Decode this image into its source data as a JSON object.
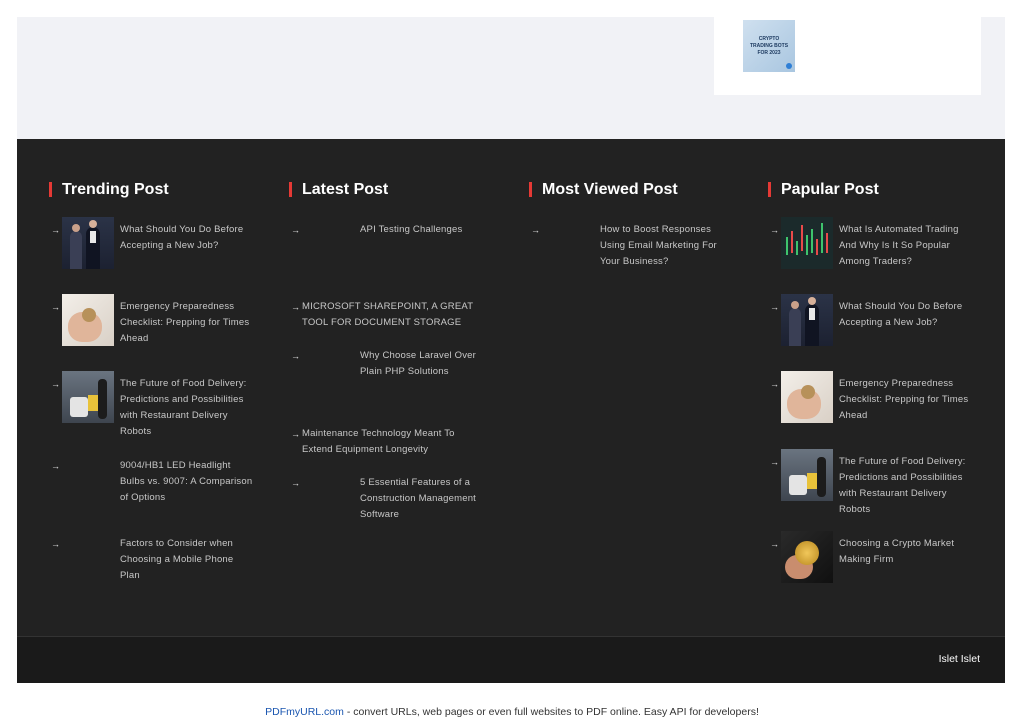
{
  "sidebar_card": {
    "thumb_text": "CRYPTO TRADING BOTS FOR 2023"
  },
  "columns": [
    {
      "title": "Trending Post",
      "items": [
        {
          "text": "What Should You Do Before Accepting a New Job?",
          "thumb": "job-interview-photo"
        },
        {
          "text": "Emergency Preparedness Checklist: Prepping for Times Ahead",
          "thumb": "hand-coin-photo"
        },
        {
          "text": "The Future of Food Delivery: Predictions and Possibilities with Restaurant Delivery Robots",
          "thumb": "delivery-robot-photo"
        },
        {
          "text": "9004/HB1 LED Headlight Bulbs vs. 9007: A Comparison of Options",
          "thumb": ""
        },
        {
          "text": "Factors to Consider when Choosing a Mobile Phone Plan",
          "thumb": ""
        }
      ]
    },
    {
      "title": "Latest Post",
      "items": [
        {
          "text": "API Testing Challenges",
          "thumb": ""
        },
        {
          "text": "MICROSOFT SHAREPOINT, A GREAT TOOL FOR DOCUMENT STORAGE",
          "thumb": "none"
        },
        {
          "text": "Why Choose Laravel Over Plain PHP Solutions",
          "thumb": ""
        },
        {
          "text": "Maintenance Technology Meant To Extend Equipment Longevity",
          "thumb": "none"
        },
        {
          "text": "5 Essential Features of a Construction Management Software",
          "thumb": ""
        }
      ]
    },
    {
      "title": "Most Viewed Post",
      "items": [
        {
          "text": "How to Boost Responses Using Email Marketing For Your Business?",
          "thumb": ""
        }
      ]
    },
    {
      "title": "Papular Post",
      "items": [
        {
          "text": "What Is Automated Trading And Why Is It So Popular Among Traders?",
          "thumb": "trading-chart-photo"
        },
        {
          "text": "What Should You Do Before Accepting a New Job?",
          "thumb": "job-interview-photo"
        },
        {
          "text": "Emergency Preparedness Checklist: Prepping for Times Ahead",
          "thumb": "hand-coin-photo"
        },
        {
          "text": "The Future of Food Delivery: Predictions and Possibilities with Restaurant Delivery Robots",
          "thumb": "delivery-robot-photo"
        },
        {
          "text": "Choosing a Crypto Market Making Firm",
          "thumb": "gold-coin-photo"
        }
      ]
    }
  ],
  "bottom_bar": {
    "brand": "Islet Islet"
  },
  "pdf_note": {
    "link": "PDFmyURL.com",
    "text": " - convert URLs, web pages or even full websites to PDF online. Easy API for developers!"
  },
  "colors": {
    "footer_bg": "#222222",
    "accent": "#e53935",
    "top_bg": "#f1f2f6"
  },
  "icons": {
    "list_arrow": "→"
  }
}
